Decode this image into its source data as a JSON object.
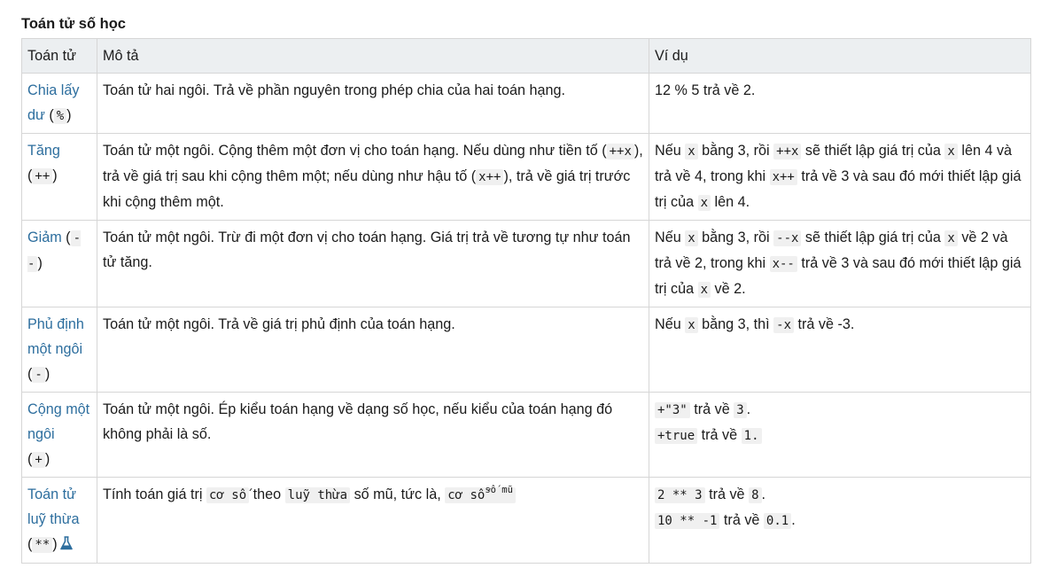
{
  "section_title": "Toán tử số học",
  "headers": [
    "Toán tử",
    "Mô tả",
    "Ví dụ"
  ],
  "rows": [
    {
      "op_name": "Chia lấy dư",
      "op_symbol": "%",
      "desc": "Toán tử hai ngôi. Trả về phần nguyên trong phép chia của hai toán hạng.",
      "example": "12 % 5 trả về 2."
    },
    {
      "op_name": "Tăng",
      "op_symbol": "++",
      "desc": {
        "t1": "Toán tử một ngôi. Cộng thêm một đơn vị cho toán hạng. Nếu dùng như tiền tố (",
        "c1": "++x",
        "t2": "), trả về giá trị sau khi cộng thêm một; nếu dùng như hậu tố (",
        "c2": "x++",
        "t3": "), trả về giá trị trước khi cộng thêm một."
      },
      "example": {
        "t1": "Nếu ",
        "c1": "x",
        "t2": " bằng 3, rồi ",
        "c2": "++x",
        "t3": " sẽ thiết lập giá trị của ",
        "c3": "x",
        "t4": " lên 4 và trả về 4, trong khi ",
        "c4": "x++",
        "t5": " trả về 3 và sau đó mới thiết lập giá trị của ",
        "c5": "x",
        "t6": " lên 4."
      }
    },
    {
      "op_name": "Giảm",
      "op_symbol": "--",
      "desc": "Toán tử một ngôi. Trừ đi một đơn vị cho toán hạng. Giá trị trả về tương tự như toán tử tăng.",
      "example": {
        "t1": "Nếu ",
        "c1": "x",
        "t2": " bằng 3, rồi ",
        "c2": "--x",
        "t3": " sẽ thiết lập giá trị của ",
        "c3": "x",
        "t4": " về 2 và trả về 2, trong khi ",
        "c4": "x--",
        "t5": " trả về 3 và sau đó mới thiết lập giá trị của ",
        "c5": "x",
        "t6": " về 2."
      }
    },
    {
      "op_name": "Phủ định một ngôi",
      "op_symbol": "-",
      "desc": "Toán tử một ngôi. Trả về giá trị phủ định của toán hạng.",
      "example": {
        "t1": "Nếu ",
        "c1": "x",
        "t2": " bằng 3, thì ",
        "c2": "-x",
        "t3": " trả về -3."
      }
    },
    {
      "op_name": "Cộng một ngôi",
      "op_symbol": "+",
      "desc": "Toán tử một ngôi. Ép kiểu toán hạng về dạng số học, nếu kiểu của toán hạng đó không phải là số.",
      "example": {
        "l1c1": "+\"3\"",
        "l1t": " trả về ",
        "l1c2": "3",
        "l1end": ".",
        "l2c1": "+true",
        "l2t": " trả về ",
        "l2c2": "1."
      }
    },
    {
      "op_name": "Toán tử luỹ thừa",
      "op_symbol": "**",
      "desc": {
        "t1": "Tính toán giá trị ",
        "c1": "cơ số",
        "t2": " theo ",
        "c2": "luỹ thừa",
        "t3": " số mũ, tức là, ",
        "c3": "cơ số",
        "sup": "số mũ"
      },
      "example": {
        "l1c1": "2 ** 3",
        "l1t": " trả về ",
        "l1c2": "8",
        "l1end": ".",
        "l2c1": "10 ** -1",
        "l2t": " trả về ",
        "l2c2": "0.1",
        "l2end": "."
      }
    }
  ],
  "icons": {
    "experimental": "flask-icon"
  },
  "colors": {
    "link": "#2d6e9e",
    "header_bg": "#eceff1",
    "code_bg": "#f0f0f0",
    "border": "#d6d6d6"
  }
}
